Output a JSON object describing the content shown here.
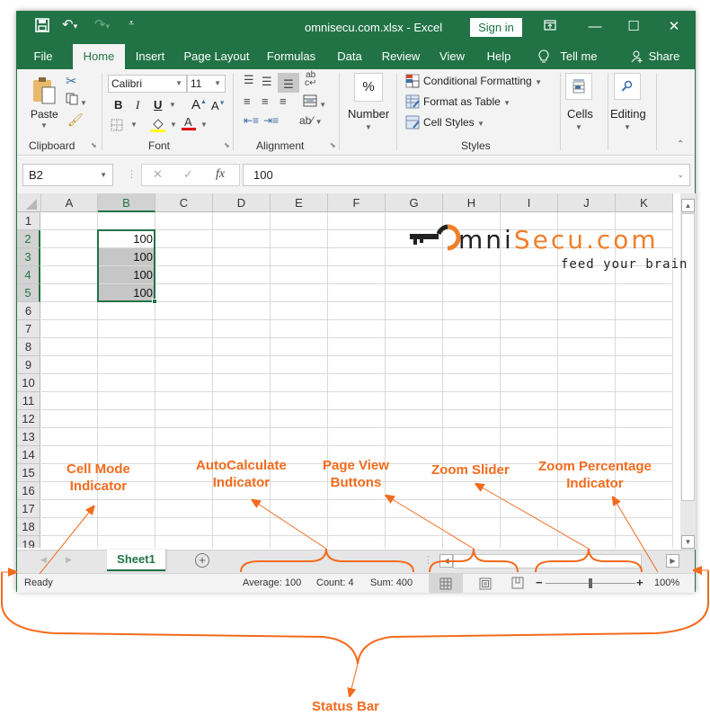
{
  "titlebar": {
    "title": "omnisecu.com.xlsx  -  Excel",
    "sign_in": "Sign in",
    "icons": [
      "save-icon",
      "undo-icon",
      "redo-icon",
      "customize-qat-icon",
      "ribbon-display-icon",
      "minimize-icon",
      "maximize-icon",
      "close-icon"
    ]
  },
  "tabs": [
    {
      "label": "File"
    },
    {
      "label": "Home",
      "active": true
    },
    {
      "label": "Insert"
    },
    {
      "label": "Page Layout"
    },
    {
      "label": "Formulas"
    },
    {
      "label": "Data"
    },
    {
      "label": "Review"
    },
    {
      "label": "View"
    },
    {
      "label": "Help"
    }
  ],
  "tell_me": "Tell me",
  "share": "Share",
  "ribbon": {
    "clipboard": {
      "label": "Clipboard",
      "paste": "Paste"
    },
    "font": {
      "label": "Font",
      "font_name": "Calibri",
      "font_size": "11",
      "bold": "B",
      "italic": "I",
      "underline": "U"
    },
    "alignment": {
      "label": "Alignment"
    },
    "number": {
      "label": "Number",
      "symbol": "%"
    },
    "styles": {
      "label": "Styles",
      "conditional_formatting": "Conditional Formatting",
      "format_as_table": "Format as Table",
      "cell_styles": "Cell Styles"
    },
    "cells": {
      "label": "Cells"
    },
    "editing": {
      "label": "Editing"
    }
  },
  "formula_bar": {
    "name_box": "B2",
    "fx": "fx",
    "value": "100"
  },
  "grid": {
    "columns": [
      "A",
      "B",
      "C",
      "D",
      "E",
      "F",
      "G",
      "H",
      "I",
      "J",
      "K"
    ],
    "rows": [
      "1",
      "2",
      "3",
      "4",
      "5",
      "6",
      "7",
      "8",
      "9",
      "10",
      "11",
      "12",
      "13",
      "14",
      "15",
      "16",
      "17",
      "18",
      "19"
    ],
    "selected_column": "B",
    "selected_rows": [
      "2",
      "3",
      "4",
      "5"
    ],
    "cells": [
      {
        "ref": "B2",
        "value": "100"
      },
      {
        "ref": "B3",
        "value": "100"
      },
      {
        "ref": "B4",
        "value": "100"
      },
      {
        "ref": "B5",
        "value": "100"
      }
    ]
  },
  "logo": {
    "brand_dark": "mni",
    "brand_orange": "Secu.com",
    "tagline": "feed your brain"
  },
  "sheets": [
    {
      "name": "Sheet1",
      "active": true
    }
  ],
  "status_bar": {
    "mode": "Ready",
    "average": "Average: 100",
    "count": "Count: 4",
    "sum": "Sum: 400",
    "view_buttons": [
      "normal-view",
      "page-layout-view",
      "page-break-preview"
    ],
    "zoom_minus": "−",
    "zoom_plus": "+",
    "zoom_percent": "100%",
    "zoom_level": 100
  },
  "annotations": {
    "cell_mode": [
      "Cell Mode",
      "Indicator"
    ],
    "autocalc": [
      "AutoCalculate",
      "Indicator"
    ],
    "page_view": [
      "Page View",
      "Buttons"
    ],
    "zoom_slider": [
      "Zoom Slider"
    ],
    "zoom_percent": [
      "Zoom Percentage",
      "Indicator"
    ],
    "status_bar": [
      "Status Bar"
    ]
  },
  "colors": {
    "excel_green": "#217346",
    "annotation_orange": "#f26b1d",
    "logo_orange": "#f07f2a"
  }
}
